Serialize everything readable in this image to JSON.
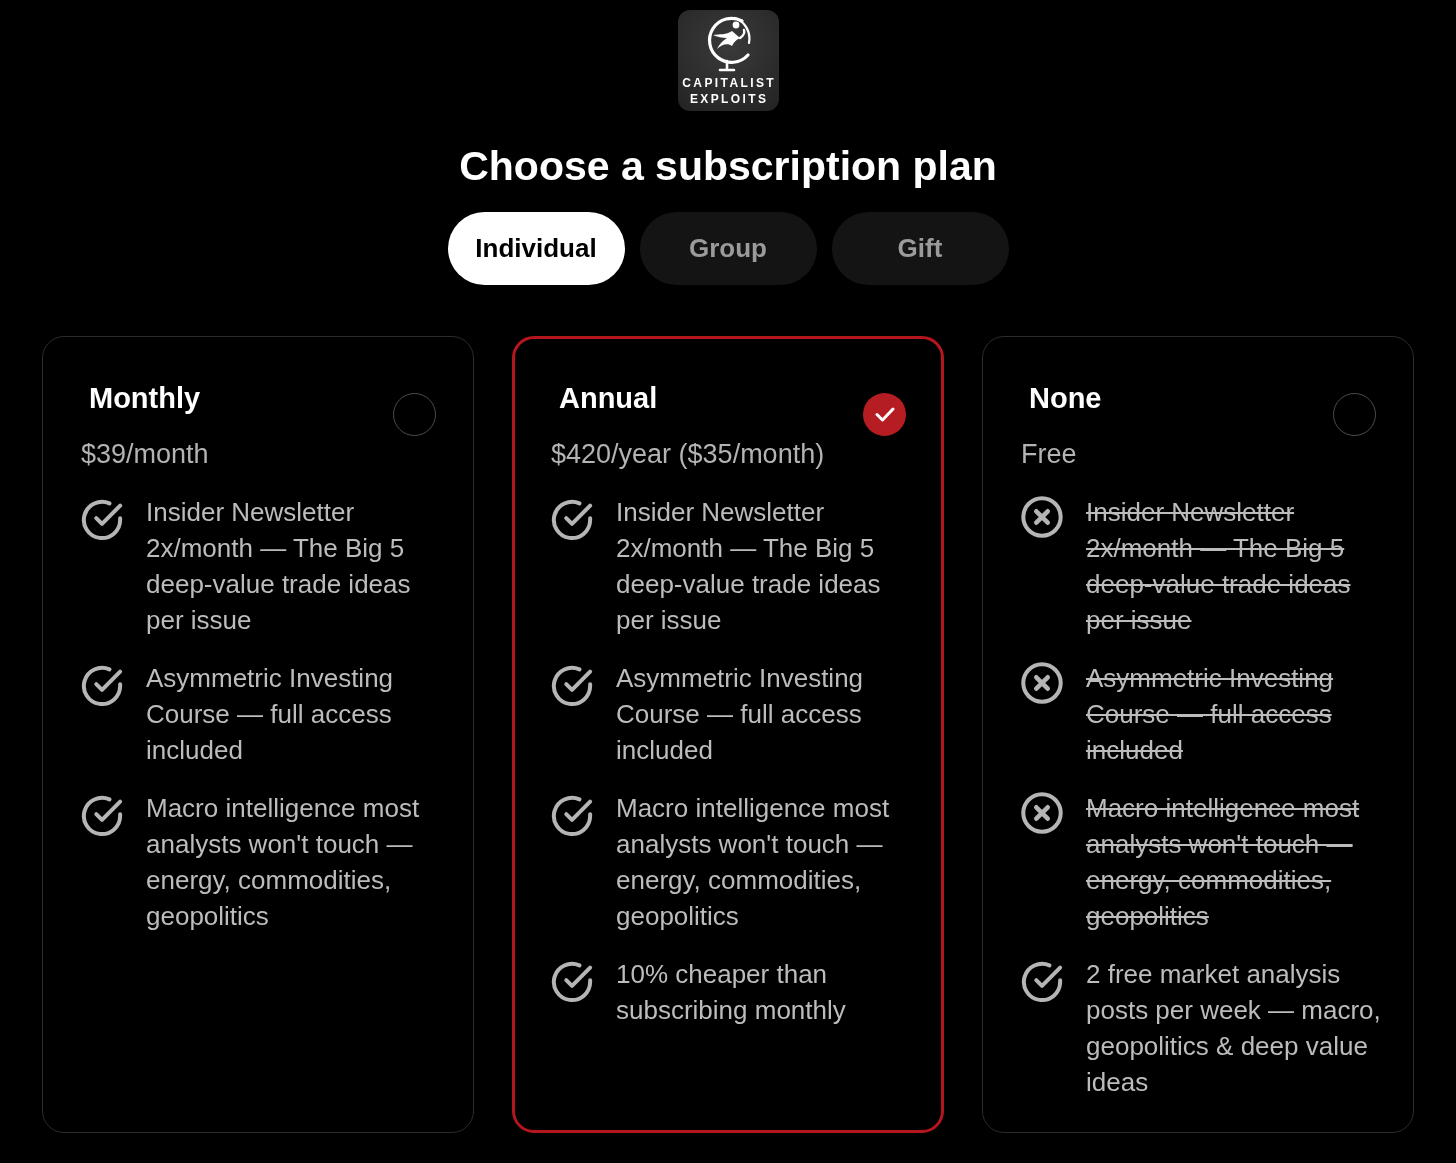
{
  "logo": {
    "lines": [
      "CAPITALIST",
      "EXPLOITS"
    ]
  },
  "title": "Choose a subscription plan",
  "tabs": [
    {
      "label": "Individual",
      "selected": true
    },
    {
      "label": "Group",
      "selected": false
    },
    {
      "label": "Gift",
      "selected": false
    }
  ],
  "plans": [
    {
      "name": "Monthly",
      "price": "$39/month",
      "selected": false,
      "features": [
        {
          "text": "Insider Newsletter 2x/month — The Big 5 deep-value trade ideas per issue",
          "included": true
        },
        {
          "text": "Asymmetric Investing Course — full access included",
          "included": true
        },
        {
          "text": "Macro intelligence most analysts won't touch — energy, commodities, geopolitics",
          "included": true
        }
      ]
    },
    {
      "name": "Annual",
      "price": "$420/year ($35/month)",
      "selected": true,
      "features": [
        {
          "text": "Insider Newsletter 2x/month — The Big 5 deep-value trade ideas per issue",
          "included": true
        },
        {
          "text": "Asymmetric Investing Course — full access included",
          "included": true
        },
        {
          "text": "Macro intelligence most analysts won't touch — energy, commodities, geopolitics",
          "included": true
        },
        {
          "text": "10% cheaper than subscribing monthly",
          "included": true
        }
      ]
    },
    {
      "name": "None",
      "price": "Free",
      "selected": false,
      "features": [
        {
          "text": "Insider Newsletter 2x/month — The Big 5 deep-value trade ideas per issue",
          "included": false
        },
        {
          "text": "Asymmetric Investing Course — full access included",
          "included": false
        },
        {
          "text": "Macro intelligence most analysts won't touch — energy, commodities, geopolitics",
          "included": false
        },
        {
          "text": "2 free market analysis posts per week — macro, geopolitics & deep value ideas",
          "included": true
        }
      ]
    }
  ]
}
